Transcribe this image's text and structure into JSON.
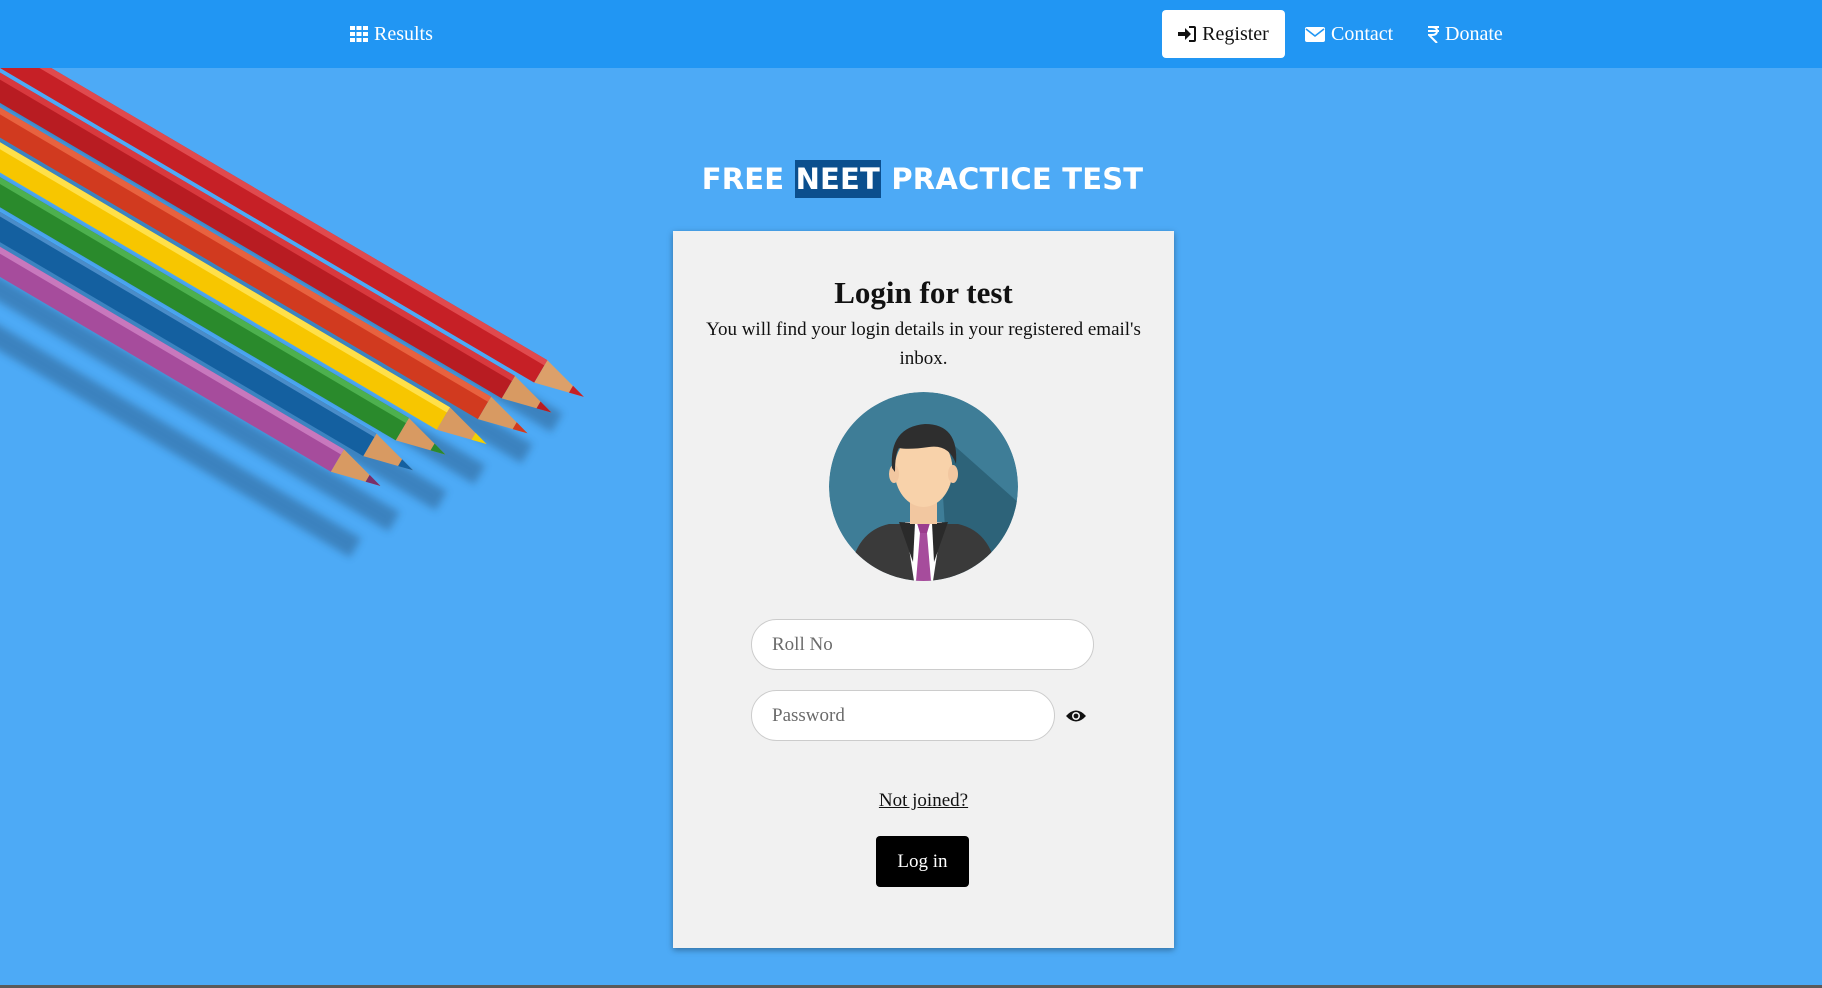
{
  "nav": {
    "results": {
      "label": "Results",
      "icon": "grid-icon"
    },
    "register": {
      "label": "Register",
      "icon": "sign-in-icon"
    },
    "contact": {
      "label": "Contact",
      "icon": "envelope-icon"
    },
    "donate": {
      "label": "Donate",
      "icon": "rupee-icon"
    }
  },
  "hero": {
    "title_before": "FREE ",
    "title_highlight": "NEET",
    "title_after": " PRACTICE TEST"
  },
  "login": {
    "title": "Login for test",
    "subtitle": "You will find your login details in your registered email's inbox.",
    "roll_placeholder": "Roll No",
    "password_placeholder": "Password",
    "not_joined": "Not joined?",
    "login_button": "Log in"
  },
  "colors": {
    "navbar": "#2196f3",
    "background": "#4daaf6",
    "title_highlight": "#0b4f8e",
    "card": "#f1f1f1",
    "button": "#000000"
  }
}
